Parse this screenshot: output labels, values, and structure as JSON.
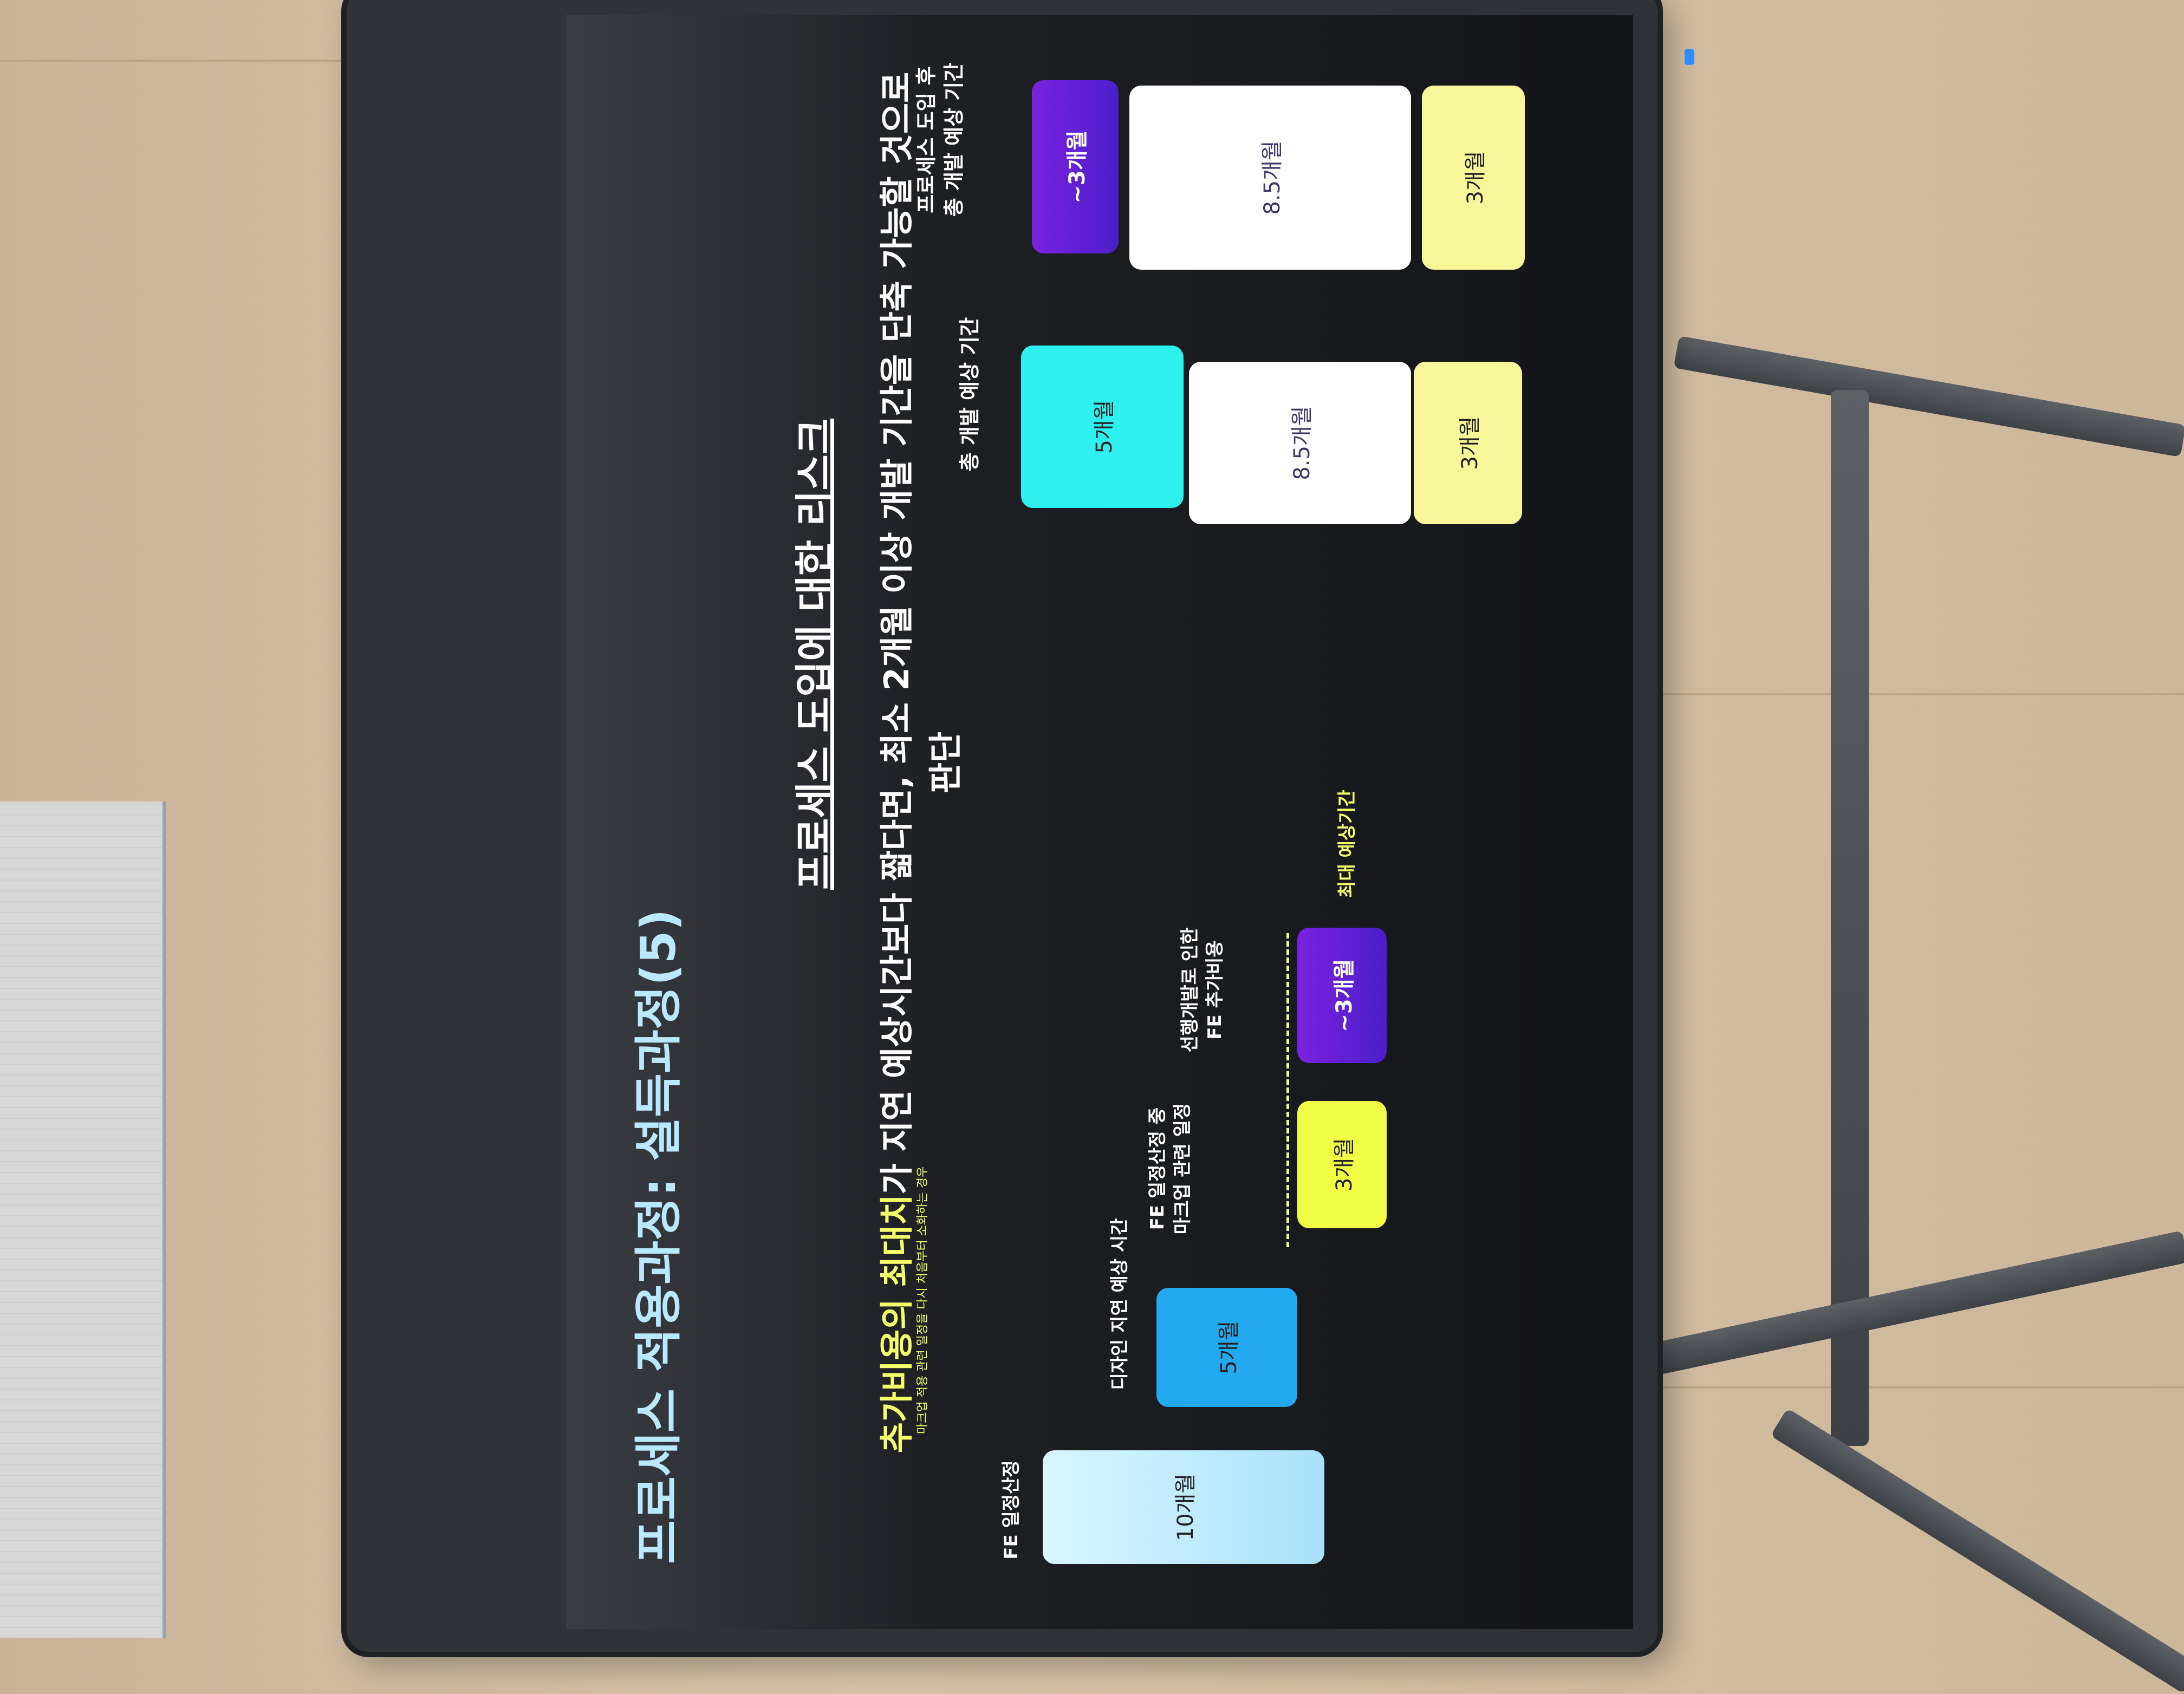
{
  "slide": {
    "title": "프로세스 적용과정: 설득과정(5)",
    "risk_title": "프로세스 도입에 대한 리스크",
    "conclusion": {
      "prefix": "추가비용의 ",
      "highlight": "최대치",
      "rest": "가 지연 예상시간보다 짧다면, 최소 2개월 이상 개발 기간을 단축 가능할 것으로 판단"
    },
    "footnote": "마크업 적용 관련 일정을 다시 처음부터 소화하는 경우",
    "timeline": {
      "fe_label": "FE 일정산정",
      "fe_value": "10개월",
      "delay_label": "디자인 지연 예상 시간",
      "delay_value": "5개월",
      "markup_label_line1": "FE 일정산정 중",
      "markup_label_line2": "마크업 관련 일정",
      "markup_value": "3개월",
      "extra_label_line1": "선행개발로 인한",
      "extra_label_line2": "FE 추가비용",
      "extra_value": "~3개월",
      "max_label": "최대 예상기간"
    },
    "totals": {
      "before_label": "총 개발 예상 기간",
      "before": [
        "5개월",
        "8.5개월",
        "3개월"
      ],
      "after_label_line1": "프로세스 도입 후",
      "after_label_line2": "총 개발 예상 기간",
      "after": [
        "~3개월",
        "8.5개월",
        "3개월"
      ]
    }
  },
  "colors": {
    "title": "#b9e8ff",
    "highlight": "#f4ff6a",
    "cyan": "#2ef0ef",
    "blue": "#23a9ef",
    "yellow": "#f0ff45",
    "purple": "#6a1fd8",
    "pale_yellow": "#f7f79a"
  }
}
